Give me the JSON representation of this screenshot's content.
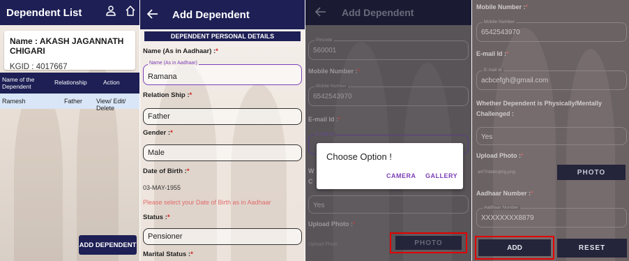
{
  "screen1": {
    "title": "Dependent List",
    "icons": [
      "person-icon",
      "home-icon"
    ],
    "name_line": "Name : AKASH JAGANNATH CHIGARI",
    "kgid_line": "KGID : 4017667",
    "table": {
      "headers": [
        "Name of the Dependent",
        "Relationship",
        "Action"
      ],
      "rows": [
        {
          "name": "Ramesh",
          "relationship": "Father",
          "action": "View/ Edit/ Delete"
        }
      ]
    },
    "add_button": "ADD DEPENDENT"
  },
  "screen2": {
    "back_icon": "back-arrow-icon",
    "title": "Add Dependent",
    "section": "DEPENDENT PERSONAL DETAILS",
    "name_label": "Name (As in Aadhaar) :",
    "name_float": "Name (As in Aadhaar)",
    "name_value": "Ramana",
    "relation_label": "Relation Ship :",
    "relation_value": "Father",
    "gender_label": "Gender :",
    "gender_value": "Male",
    "dob_label": "Date of Birth :",
    "dob_value": "03-MAY-1955",
    "dob_hint": "Please select your Date of Birth as in Aadhaar",
    "status_label": "Status :",
    "status_value": "Pensioner",
    "marital_label": "Marital Status :",
    "required_mark": "*"
  },
  "screen3": {
    "back_icon": "back-arrow-icon",
    "title": "Add Dependent",
    "pincode_float": "Pincode",
    "pincode_value": "560001",
    "mobile_label": "Mobile Number :",
    "mobile_float": "Mobile Number",
    "mobile_value": "6542543970",
    "email_label": "E-mail Id :",
    "email_float": "E-mail Id",
    "challenged_partial_1": "W",
    "challenged_partial_2": "C",
    "challenged_value": "Yes",
    "upload_label": "Upload Photo :",
    "upload_hint": "Upload Photo",
    "photo_button": "PHOTO",
    "dialog": {
      "title": "Choose Option !",
      "camera": "CAMERA",
      "gallery": "GALLERY"
    }
  },
  "screen4": {
    "mobile_label": "Mobile Number :",
    "mobile_float": "Mobile Number",
    "mobile_value": "6542543970",
    "email_label": "E-mail Id :",
    "email_float": "E-mail Id",
    "email_value": "acbcefgh@gmail.com",
    "challenged_label_1": "Whether Dependent is Physically/Mentally",
    "challenged_label_2": "Challenged :",
    "challenged_value": "Yes",
    "upload_label": "Upload Photo :",
    "upload_file": "a470dabcqmg.png",
    "photo_button": "PHOTO",
    "aadhaar_label": "Aadhaar Number :",
    "aadhaar_float": "Aadhaar Number",
    "aadhaar_value": "XXXXXXXX8879",
    "add_button": "ADD",
    "reset_button": "RESET"
  },
  "colors": {
    "appbar": "#1d1f55",
    "required": "#d21f1f",
    "accent": "#7b3fb8",
    "highlight": "#e30000"
  }
}
